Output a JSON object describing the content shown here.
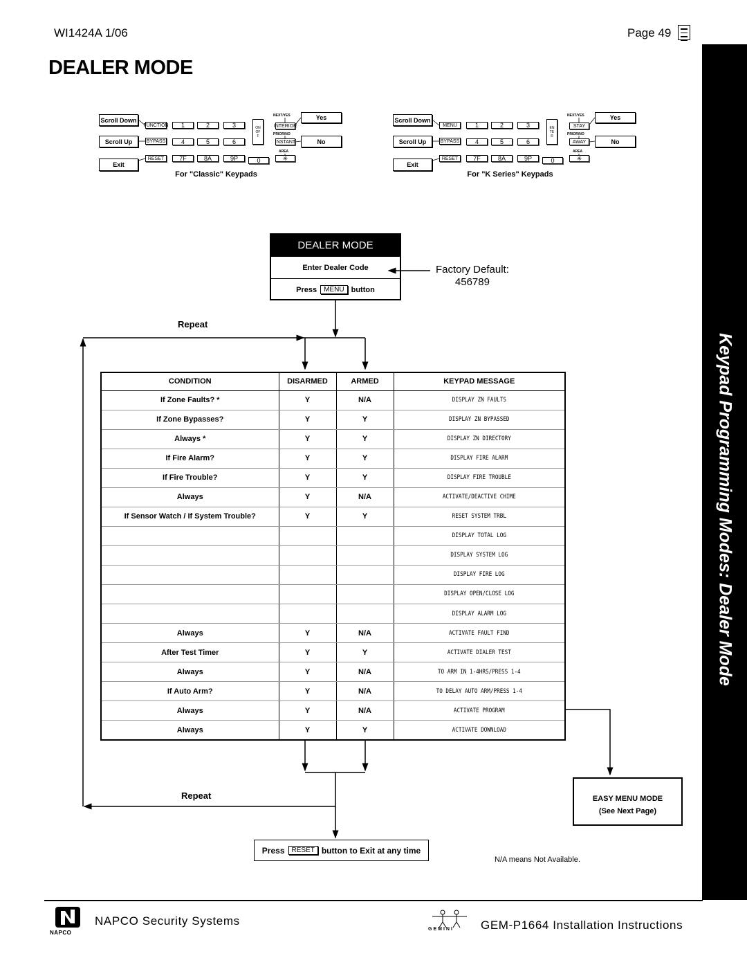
{
  "header": {
    "doc_id": "WI1424A  1/06",
    "page": "Page 49",
    "title": "DEALER MODE"
  },
  "sidebar": {
    "text": "Keypad Programming Modes: Dealer Mode"
  },
  "keypads": [
    {
      "caption": "For \"Classic\" Keypads",
      "scroll_down": "Scroll Down",
      "scroll_up": "Scroll Up",
      "exit": "Exit",
      "yes": "Yes",
      "no": "No",
      "fn_key": "FUNCTION",
      "bypass_key": "BYPASS",
      "reset_key": "RESET",
      "k1": "1",
      "k2": "2",
      "k3": "3",
      "k4": "4",
      "k5": "5",
      "k6": "6",
      "k7": "7F",
      "k8": "8A",
      "k9": "9P",
      "k0": "0",
      "star": "✳",
      "side_key": "ON OFF",
      "next_label": "NEXT/YES",
      "next_key": "INTERIOR",
      "prior_label": "PRIOR/NO",
      "prior_key": "INSTANT",
      "area_label": "AREA"
    },
    {
      "caption": "For \"K Series\" Keypads",
      "scroll_down": "Scroll Down",
      "scroll_up": "Scroll Up",
      "exit": "Exit",
      "yes": "Yes",
      "no": "No",
      "fn_key": "MENU",
      "bypass_key": "BYPASS",
      "reset_key": "RESET",
      "k1": "1",
      "k2": "2",
      "k3": "3",
      "k4": "4",
      "k5": "5",
      "k6": "6",
      "k7": "7F",
      "k8": "8A",
      "k9": "9P",
      "k0": "0",
      "star": "✳",
      "side_key": "ENTER",
      "next_label": "NEXT/YES",
      "next_key": "STAY",
      "prior_label": "PRIOR/NO",
      "prior_key": "AWAY",
      "area_label": "AREA"
    }
  ],
  "dealer_box": {
    "title": "DEALER MODE",
    "step1": "Enter Dealer Code",
    "step2_pre": "Press",
    "step2_key": "MENU",
    "step2_post": "button"
  },
  "factory_default": {
    "label": "Factory Default:",
    "code": "456789"
  },
  "repeat_top": "Repeat",
  "repeat_bottom": "Repeat",
  "table": {
    "headers": [
      "CONDITION",
      "DISARMED",
      "ARMED",
      "KEYPAD MESSAGE"
    ],
    "rows": [
      [
        "If Zone Faults? *",
        "Y",
        "N/A",
        "DISPLAY ZN FAULTS"
      ],
      [
        "If Zone Bypasses?",
        "Y",
        "Y",
        "DISPLAY ZN BYPASSED"
      ],
      [
        "Always *",
        "Y",
        "Y",
        "DISPLAY ZN DIRECTORY"
      ],
      [
        "If Fire Alarm?",
        "Y",
        "Y",
        "DISPLAY FIRE ALARM"
      ],
      [
        "If Fire Trouble?",
        "Y",
        "Y",
        "DISPLAY FIRE TROUBLE"
      ],
      [
        "Always",
        "Y",
        "N/A",
        "ACTIVATE/DEACTIVE CHIME"
      ],
      [
        "If Sensor Watch / If System Trouble?",
        "Y",
        "Y",
        "RESET SYSTEM TRBL"
      ],
      [
        "",
        "",
        "",
        "DISPLAY TOTAL LOG"
      ],
      [
        "",
        "",
        "",
        "DISPLAY SYSTEM LOG"
      ],
      [
        "",
        "",
        "",
        "DISPLAY FIRE LOG"
      ],
      [
        "",
        "",
        "",
        "DISPLAY OPEN/CLOSE LOG"
      ],
      [
        "",
        "",
        "",
        "DISPLAY ALARM LOG"
      ],
      [
        "Always",
        "Y",
        "N/A",
        "ACTIVATE FAULT FIND"
      ],
      [
        "After Test Timer",
        "Y",
        "Y",
        "ACTIVATE DIALER TEST"
      ],
      [
        "Always",
        "Y",
        "N/A",
        "TO ARM IN 1-4HRS/PRESS 1-4"
      ],
      [
        "If Auto Arm?",
        "Y",
        "N/A",
        "TO DELAY AUTO ARM/PRESS 1-4"
      ],
      [
        "Always",
        "Y",
        "N/A",
        "ACTIVATE PROGRAM"
      ],
      [
        "Always",
        "Y",
        "Y",
        "ACTIVATE DOWNLOAD"
      ]
    ]
  },
  "easy_menu": {
    "title": "EASY MENU MODE",
    "sub": "(See Next Page)"
  },
  "exit_box": {
    "pre": "Press",
    "key": "RESET",
    "post": "button to Exit at any time"
  },
  "na_note": "N/A means Not Available.",
  "footer": {
    "company": "NAPCO Security Systems",
    "logo_word": "NAPCO",
    "gemini_word": "GEMINI",
    "manual": "GEM-P1664 Installation Instructions"
  }
}
